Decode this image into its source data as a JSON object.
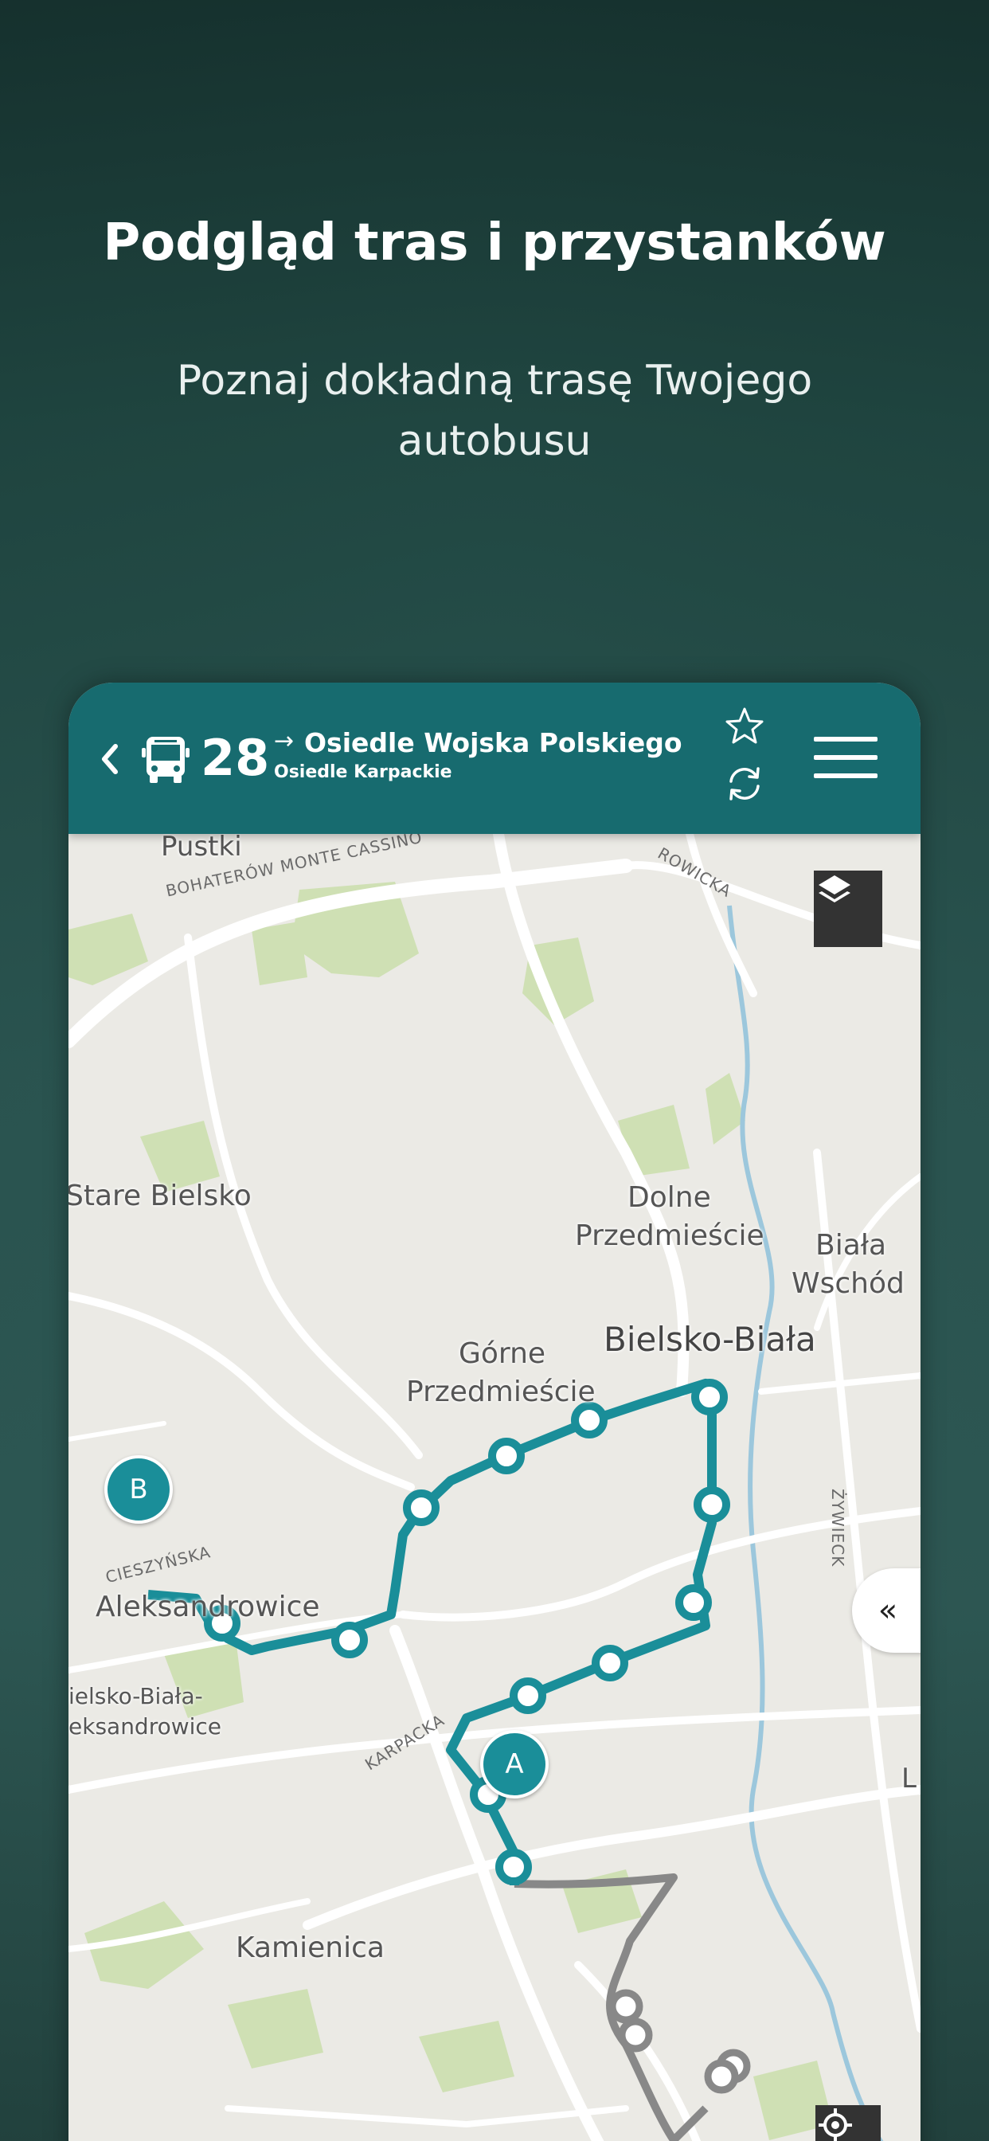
{
  "promo": {
    "headline": "Podgląd tras i przystanków",
    "subline": "Poznaj dokładną trasę Twojego autobusu"
  },
  "header": {
    "route_number": "28",
    "destination": "Osiedle Wojska Polskiego",
    "origin": "Osiedle Karpackie"
  },
  "map": {
    "places": {
      "pustki": "Pustki",
      "stare_bielsko": "Stare Bielsko",
      "dolne_1": "Dolne",
      "dolne_2": "Przedmieście",
      "biala_1": "Biała",
      "biala_2": "Wschód",
      "bielsko_biala": "Bielsko-Biała",
      "gorne_1": "Górne",
      "gorne_2": "Przedmieście",
      "aleksandrowice": "Aleksandrowice",
      "station_1": "ielsko-Biała-",
      "station_2": "eksandrowice",
      "kamienica": "Kamienica",
      "edge_l": "L"
    },
    "streets": {
      "bohaterow": "BOHATERÓW MONTE CASSINO",
      "rowicka": "ROWICKA",
      "cieszynska": "CIESZYŃSKA",
      "karpacka": "KARPACKA",
      "zywiecka": "ŻYWIECK"
    },
    "markers": {
      "start": "A",
      "end": "B"
    },
    "collapse_label": "«",
    "route_color": "#1a8e99",
    "other_route_color": "#888888"
  }
}
